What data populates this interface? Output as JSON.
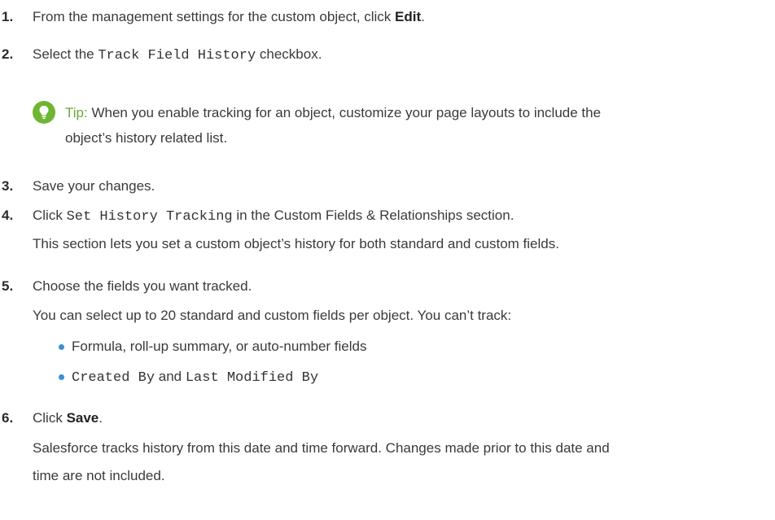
{
  "steps": [
    {
      "number": "1.",
      "pre": "From the management settings for the custom object, click ",
      "bold": "Edit",
      "post": "."
    },
    {
      "number": "2.",
      "pre": "Select the ",
      "code": "Track Field History",
      "post": " checkbox."
    },
    {
      "number": "3.",
      "text": "Save your changes."
    },
    {
      "number": "4.",
      "pre": "Click ",
      "code": "Set History Tracking",
      "post": " in the Custom Fields & Relationships section.",
      "detail": "This section lets you set a custom object’s history for both standard and custom fields."
    },
    {
      "number": "5.",
      "text": "Choose the fields you want tracked.",
      "detail": "You can select up to 20 standard and custom fields per object. You can’t track:"
    },
    {
      "number": "6.",
      "pre": "Click ",
      "bold": "Save",
      "post": ".",
      "detail_line1": "Salesforce tracks history from this date and time forward. Changes made prior to this date and",
      "detail_line2": "time are not included."
    }
  ],
  "tip": {
    "label": "Tip:",
    "line1": "When you enable tracking for an object, customize your page layouts to include the",
    "line2": "object’s history related list."
  },
  "bullets": {
    "item1": "Formula, roll-up summary, or auto-number fields",
    "item2_code_a": "Created By",
    "item2_and": " and ",
    "item2_code_b": "Last Modified By"
  },
  "colors": {
    "tip_icon": "#6fb532",
    "bullet": "#3b8fd6",
    "tip_label": "#6aa83a"
  }
}
